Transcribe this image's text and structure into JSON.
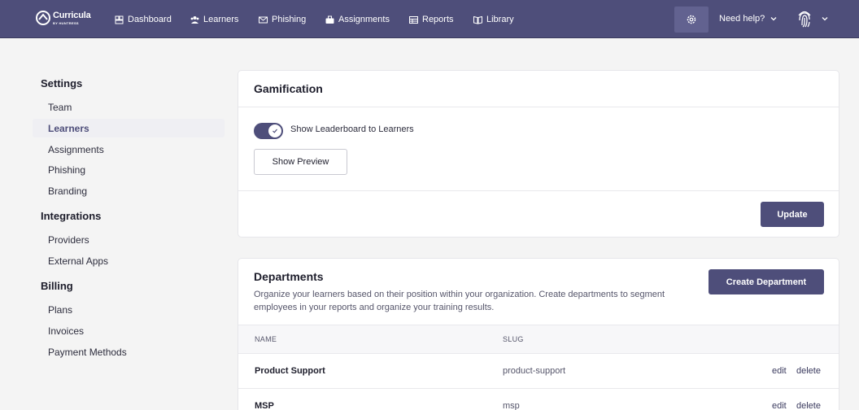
{
  "brand": {
    "name": "Curricula",
    "sub": "BY HUNTRESS"
  },
  "nav": {
    "items": [
      "Dashboard",
      "Learners",
      "Phishing",
      "Assignments",
      "Reports",
      "Library"
    ],
    "help": "Need help?"
  },
  "sidebar": {
    "settings_title": "Settings",
    "settings_items": [
      "Team",
      "Learners",
      "Assignments",
      "Phishing",
      "Branding"
    ],
    "integrations_title": "Integrations",
    "integrations_items": [
      "Providers",
      "External Apps"
    ],
    "billing_title": "Billing",
    "billing_items": [
      "Plans",
      "Invoices",
      "Payment Methods"
    ],
    "active": "Learners"
  },
  "gamification": {
    "title": "Gamification",
    "toggle_label": "Show Leaderboard to Learners",
    "toggle_on": true,
    "preview_button": "Show Preview",
    "update_button": "Update"
  },
  "departments": {
    "title": "Departments",
    "description": "Organize your learners based on their position within your organization. Create departments to segment employees in your reports and organize your training results.",
    "create_button": "Create Department",
    "columns": [
      "NAME",
      "SLUG"
    ],
    "rows": [
      {
        "name": "Product Support",
        "slug": "product-support"
      },
      {
        "name": "MSP",
        "slug": "msp"
      }
    ],
    "edit_label": "edit",
    "delete_label": "delete"
  },
  "colors": {
    "accent": "#4e4e7a",
    "background": "#f4f4f4"
  }
}
